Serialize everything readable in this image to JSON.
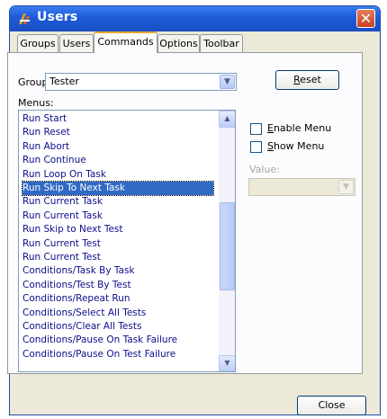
{
  "window": {
    "title": "Users",
    "close_glyph": "✕"
  },
  "tabs": [
    {
      "label": "Groups"
    },
    {
      "label": "Users"
    },
    {
      "label": "Commands"
    },
    {
      "label": "Options"
    },
    {
      "label": "Toolbar"
    }
  ],
  "active_tab": "Commands",
  "group": {
    "label": "Group:",
    "value": "Tester"
  },
  "reset_button": {
    "first": "R",
    "rest": "eset"
  },
  "menus": {
    "label": "Menus:",
    "items": [
      "Run Start",
      "Run Reset",
      "Run Abort",
      "Run Continue",
      "Run Loop On Task",
      "Run Skip To Next Task",
      "Run Current Task",
      "Run Current Task",
      "Run Skip to Next Test",
      "Run Current Test",
      "Run Current Test",
      "Conditions/Task By Task",
      "Conditions/Test By Test",
      "Conditions/Repeat Run",
      "Conditions/Select All Tests",
      "Conditions/Clear All Tests",
      "Conditions/Pause On Task Failure",
      "Conditions/Pause On Test Failure"
    ],
    "selected_index": 5
  },
  "enable_menu": {
    "first": "E",
    "rest": "nable Menu",
    "checked": false
  },
  "show_menu": {
    "first": "S",
    "rest": "how Menu",
    "checked": false
  },
  "value": {
    "label": "Value:"
  },
  "close_button": {
    "label": "Close"
  },
  "colors": {
    "title_bar": "#1d5ad8",
    "selection": "#316ac5",
    "list_text": "#0d0d8c",
    "window_bg": "#ece9d8"
  },
  "icons": [
    "app-users-icon",
    "close-icon",
    "chevron-down-icon",
    "scroll-up-icon",
    "scroll-down-icon"
  ]
}
